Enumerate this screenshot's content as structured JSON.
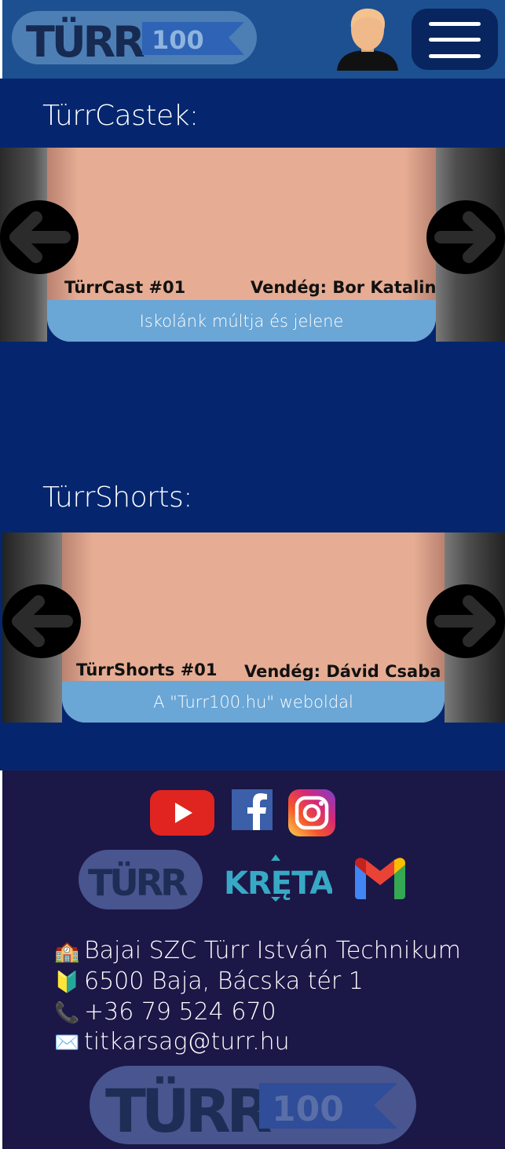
{
  "header": {
    "logo_text": "TÜRR 100",
    "user_icon": "user-avatar-icon",
    "menu_icon": "hamburger-menu-icon"
  },
  "castek": {
    "title": "TürrCastek:",
    "episode": "TürrCast #01",
    "guest": "Vendég: Bor Katalin",
    "caption": "Iskolánk múltja és jelene"
  },
  "shorts": {
    "title": "TürrShorts:",
    "episode": "TürrShorts #01",
    "guest": "Vendég: Dávid Csaba",
    "caption": "A \"Turr100.hu\" weboldal"
  },
  "footer": {
    "social": [
      "youtube-icon",
      "facebook-icon",
      "instagram-icon"
    ],
    "links": [
      "turr-logo",
      "kreta-logo",
      "gmail-icon"
    ],
    "kreta_text": "KRĘTA",
    "contact": {
      "school": "Bajai SZC Türr István Technikum",
      "address": "6500 Baja, Bácska tér 1",
      "phone": "+36 79 524 670",
      "email": "titkarsag@turr.hu"
    }
  },
  "colors": {
    "page_bg": "#05266e",
    "header_bg": "#1d5090",
    "footer_bg": "#1b1747",
    "card_strip": "#6aa6d6",
    "card_body": "#e6ad94"
  }
}
